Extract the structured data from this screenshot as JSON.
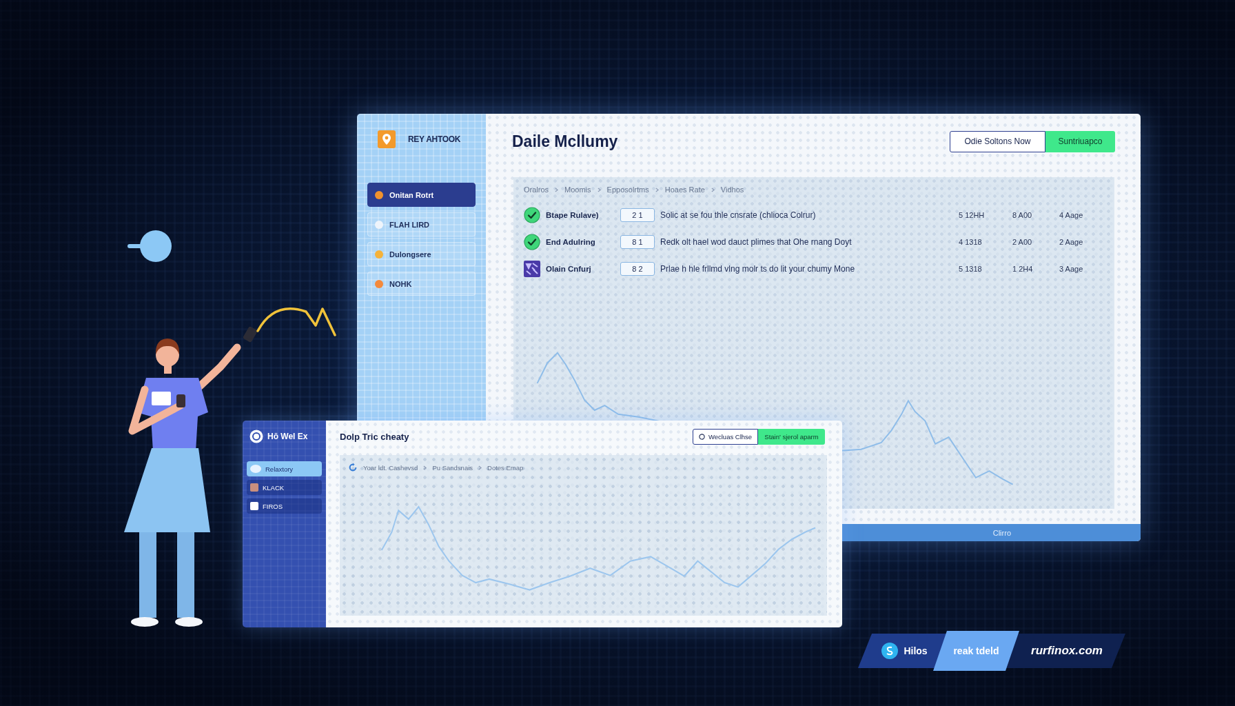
{
  "main_window": {
    "sidebar": {
      "logo": "REY AHTOOK",
      "items": [
        {
          "label": "Onitan Rotrt",
          "selected": true,
          "color": "#f0922e"
        },
        {
          "label": "FLAH LIRD",
          "selected": false,
          "color": "#eef4fb"
        },
        {
          "label": "Dulongsere",
          "selected": false,
          "color": "#f5b23a"
        },
        {
          "label": "NOHK",
          "selected": false,
          "color": "#f48a3c"
        }
      ]
    },
    "title": "Daile Mcllumy",
    "buttons": [
      {
        "label": "Odie Soltons Now",
        "kind": "outline"
      },
      {
        "label": "Suntriuapco",
        "kind": "primary"
      }
    ],
    "breadcrumb": [
      "Oralros",
      "Moomis",
      "Epposolrtms",
      "Hoaes Rate",
      "Vidhos"
    ],
    "rows": [
      {
        "kind": "check",
        "name": "Btape Rulave)",
        "badge": "2 1",
        "description": "Solic at se fou thle cnsrate (chlioca Colrur)",
        "column_3": "5 12HH",
        "column_4": "8 A00",
        "column_5": "4 Aage"
      },
      {
        "kind": "check",
        "name": "End Adulring",
        "badge": "8 1",
        "description": "Redk olt hael wod dauct plimes that Ohe rnang Doyt",
        "column_3": "4 1318",
        "column_4": "2 A00",
        "column_5": "2 Aage"
      },
      {
        "kind": "pattern",
        "name": "Olain Cnfurj",
        "badge": "8 2",
        "description": "Prlae h hle frllmd vlng molr ts do lit your chumy Mone",
        "column_3": "5 1318",
        "column_4": "1 2H4",
        "column_5": "3 Aage"
      }
    ],
    "footer": "Clirro"
  },
  "second_window": {
    "sidebar": {
      "logo": "Hŏ Wel Ex",
      "items": [
        {
          "label": "Relaxtory",
          "selected": true,
          "color": "#e9f3ff"
        },
        {
          "label": "KLACK",
          "selected": false,
          "color": "#c98f7e"
        },
        {
          "label": "FIROS",
          "selected": false,
          "color": "#ffffff"
        }
      ]
    },
    "title": "Dolp Tric cheaty",
    "buttons": [
      {
        "label": "Wecluas Clhse",
        "kind": "outline",
        "icon": true
      },
      {
        "label": "Stain' sjerol aparm",
        "kind": "primary"
      }
    ],
    "breadcrumb": [
      "Yoar ldt. Cashevsd",
      "Pu Sandsnais",
      "Dotes Emap"
    ]
  },
  "tags": [
    {
      "label": "Hilos",
      "kind": "icon"
    },
    {
      "label": "reak tdeld",
      "kind": "light"
    },
    {
      "label": "rurfinox.com",
      "kind": "dark"
    }
  ]
}
